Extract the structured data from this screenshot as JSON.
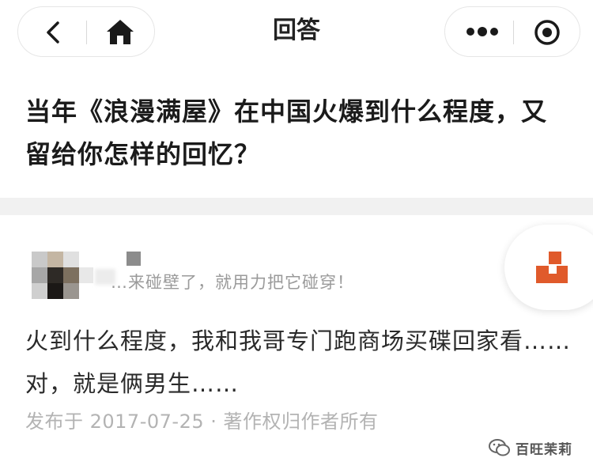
{
  "nav": {
    "title": "回答",
    "back_icon": "chevron-left-icon",
    "home_icon": "home-icon",
    "more_icon": "more-dots-icon",
    "target_icon": "circle-target-icon"
  },
  "question": {
    "title": "当年《浪漫满屋》在中国火爆到什么程度，又留给你怎样的回忆？"
  },
  "answer": {
    "author_bio": "…来碰壁了，就用力把它碰穿！",
    "body": "火到什么程度，我和我哥专门跑商场买碟回家看……对，就是俩男生……",
    "meta": "发布于 2017-07-25 · 著作权归作者所有",
    "float_logo_color": "#e05a2b"
  },
  "watermark": {
    "text": "百旺茉莉",
    "icon": "wechat-icon"
  },
  "colors": {
    "accent": "#e05a2b",
    "separator": "#f1f1f1",
    "meta_text": "#b3b3b3"
  }
}
